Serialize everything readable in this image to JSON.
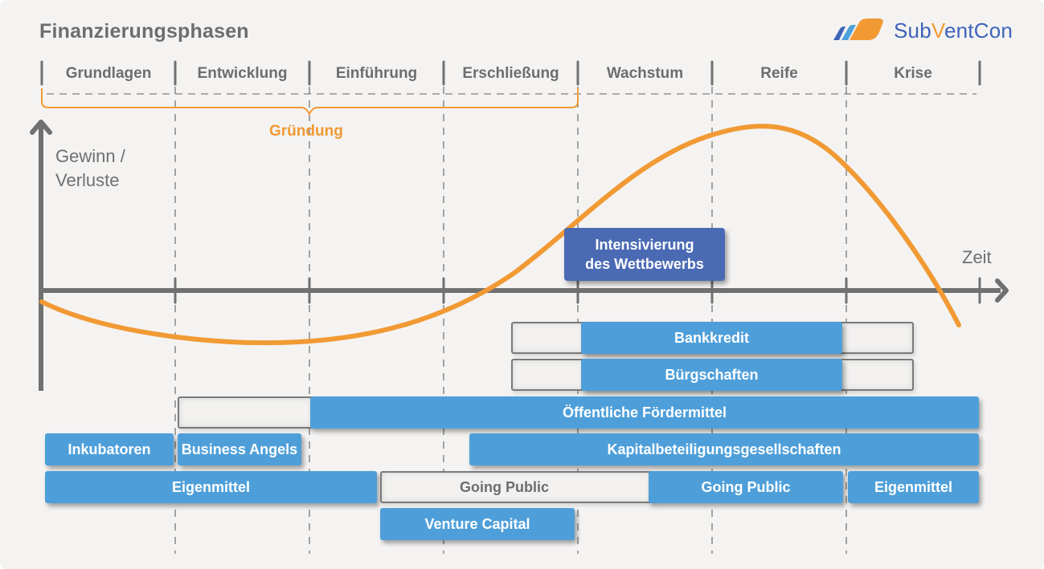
{
  "header": {
    "title": "Finanzierungsphasen",
    "logo": {
      "name_part1": "Sub",
      "name_part2": "V",
      "name_part3": "entCon",
      "colors": {
        "blue": "#3e63b8",
        "light_blue": "#4e9fd9",
        "orange": "#f19a34"
      }
    }
  },
  "phases": [
    {
      "label": "Grundlagen"
    },
    {
      "label": "Entwicklung"
    },
    {
      "label": "Einführung"
    },
    {
      "label": "Erschließung"
    },
    {
      "label": "Wachstum"
    },
    {
      "label": "Reife"
    },
    {
      "label": "Krise"
    }
  ],
  "bracket": {
    "label": "Gründung",
    "spans_phases": [
      "Grundlagen",
      "Entwicklung",
      "Einführung",
      "Erschließung"
    ],
    "color": "#f19a34"
  },
  "axes": {
    "y_label_line1": "Gewinn /",
    "y_label_line2": "Verluste",
    "x_label": "Zeit"
  },
  "curve": {
    "name": "Gewinn-/Verlustkurve",
    "color": "#f19a34",
    "description": "starts slightly negative, minimum in Entwicklung/Einführung, crosses zero in Erschließung, peak in Reife, falls below zero in Krise"
  },
  "callout": {
    "line1": "Intensivierung",
    "line2": "des Wettbewerbs",
    "color": "#4b6ab4"
  },
  "financing_bars": [
    {
      "id": "bankkredit",
      "label": "Bankkredit",
      "solid_from_phase": 5,
      "solid_to_phase": 6.95,
      "outline_from_phase": 4.5,
      "outline_to_phase": 7.5
    },
    {
      "id": "buergschaften",
      "label": "Bürgschaften",
      "solid_from_phase": 5,
      "solid_to_phase": 6.95,
      "outline_from_phase": 4.5,
      "outline_to_phase": 7.5
    },
    {
      "id": "foerdermittel",
      "label": "Öffentliche Fördermittel",
      "solid_from_phase": 3,
      "solid_to_phase": 8,
      "outline_from_phase": 2,
      "outline_to_phase": 3
    },
    {
      "id": "inkubatoren",
      "label": "Inkubatoren"
    },
    {
      "id": "business-angels",
      "label": "Business Angels"
    },
    {
      "id": "kbg",
      "label": "Kapitalbeteiligungsgesellschaften"
    },
    {
      "id": "eigenmittel-1",
      "label": "Eigenmittel"
    },
    {
      "id": "going-public-outline",
      "label": "Going Public"
    },
    {
      "id": "going-public",
      "label": "Going Public"
    },
    {
      "id": "eigenmittel-2",
      "label": "Eigenmittel"
    },
    {
      "id": "venture-capital",
      "label": "Venture Capital"
    }
  ],
  "colors": {
    "bar_blue": "#4e9fd9",
    "axis_gray": "#707070",
    "background": "#f4f3f2"
  }
}
